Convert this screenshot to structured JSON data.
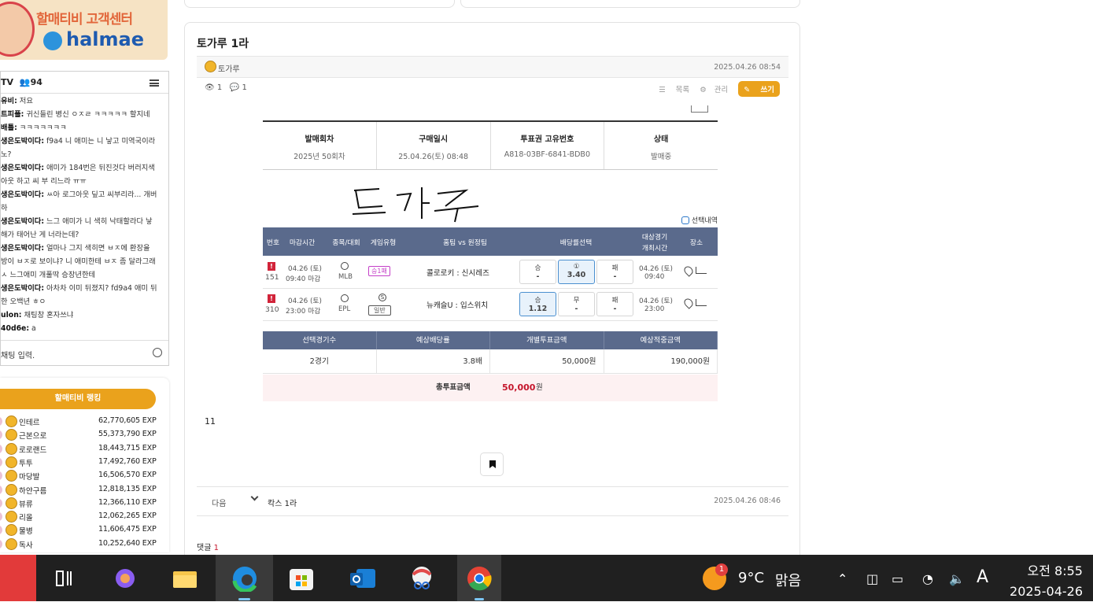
{
  "banner": {
    "title": "할매티비 고객센터",
    "brand": "halmae"
  },
  "chat": {
    "channel": "TV",
    "count": "94",
    "input_placeholder": "채팅 입력.",
    "messages": [
      {
        "user": "유비:",
        "text": " 저요"
      },
      {
        "user": "트피플:",
        "text": " 귀신들린 병신 ㅇㅈㄹ ㅋㅋㅋㅋㅋ 할지네"
      },
      {
        "user": "배틀:",
        "text": " ㅋㅋㅋㅋㅋㅋㅋ"
      },
      {
        "user": "생은도박이다:",
        "text": " f9a4 니 애미는 니 낳고 미역국이라"
      },
      {
        "user": "",
        "text": "노?"
      },
      {
        "user": "생은도박이다:",
        "text": " 애미가 184번은 뒤진것다 버러지색"
      },
      {
        "user": "",
        "text": "아웃 하고 씨 부 리느라 ㅠㅠ"
      },
      {
        "user": "생은도박이다:",
        "text": " ㅆ아 로그아웃 딮고 씨부리라... 개버"
      },
      {
        "user": "",
        "text": "하"
      },
      {
        "user": "생은도박이다:",
        "text": " 느그 애미가 니 색히 낙태할라다 낳"
      },
      {
        "user": "",
        "text": "해가 태어난 게 너라는데?"
      },
      {
        "user": "생은도박이다:",
        "text": " 얼마나 그지 색히면 ㅂㅈ에 환장을"
      },
      {
        "user": "",
        "text": "방이 ㅂㅈ로 보이냐? 니 애미한테 ㅂㅈ 좀 달라그래"
      },
      {
        "user": "",
        "text": "ㅅ 느그애미 개풀딱 승장년한테"
      },
      {
        "user": "생은도박이다:",
        "text": " 아차차 이미 뒤졌지? fd9a4 애미 뒤"
      },
      {
        "user": "",
        "text": "한 오백년 ㅎㅇ"
      },
      {
        "user": "ulon:",
        "text": " 채팅창 혼자쓰냐"
      },
      {
        "user": "40d6e:",
        "text": " a"
      }
    ]
  },
  "ranking": {
    "title": "할매티비 랭킹",
    "rows": [
      {
        "name": "인테르",
        "exp": "62,770,605 EXP"
      },
      {
        "name": "근본으로",
        "exp": "55,373,790 EXP"
      },
      {
        "name": "로로랜드",
        "exp": "18,443,715 EXP"
      },
      {
        "name": "투투",
        "exp": "17,492,760 EXP"
      },
      {
        "name": "마당발",
        "exp": "16,506,570 EXP"
      },
      {
        "name": "하얀구름",
        "exp": "12,818,135 EXP"
      },
      {
        "name": "뷰류",
        "exp": "12,366,110 EXP"
      },
      {
        "name": "리올",
        "exp": "12,062,265 EXP"
      },
      {
        "name": "물병",
        "exp": "11,606,475 EXP"
      },
      {
        "name": "독사",
        "exp": "10,252,640 EXP"
      }
    ]
  },
  "post": {
    "title": "토가루 1라",
    "author": "토가루",
    "date": "2025.04.26 08:54",
    "views": "1",
    "comments": "1",
    "actions": {
      "list": "목록",
      "manage": "관리",
      "write": "쓰기"
    },
    "body_text": "11",
    "next": {
      "label": "다음",
      "title": "칵스 1라",
      "date": "2025.04.26 08:46"
    },
    "comments_label": "댓글",
    "comments_count": "1"
  },
  "ticket": {
    "header": [
      {
        "h": "발매회차",
        "v": "2025년 50회차"
      },
      {
        "h": "구매일시",
        "v": "25.04.26(토) 08:48"
      },
      {
        "h": "투표권 고유번호",
        "v": "A818-03BF-6841-BDB0"
      },
      {
        "h": "상태",
        "v": "발매중"
      }
    ],
    "signature": "토가루",
    "select_label": "선택내역",
    "columns": {
      "num": "번호",
      "deadline": "마감시간",
      "league": "종목/대회",
      "type": "게임유형",
      "teams": "홈팀 vs 원정팀",
      "odds": "배당률선택",
      "time1": "대상경기",
      "time2": "개최시간",
      "place": "장소"
    },
    "games": [
      {
        "num": "151",
        "d1": "04.26 (토)",
        "d2": "09:40 마감",
        "league": "MLB",
        "type": "승1패",
        "teams": "콜로로키 : 신시레즈",
        "o1": {
          "l": "승",
          "v": "-"
        },
        "o2": {
          "l": "①",
          "v": "3.40"
        },
        "o3": {
          "l": "패",
          "v": "-"
        },
        "t1": "04.26 (토)",
        "t2": "09:40",
        "selected": "o2"
      },
      {
        "num": "310",
        "d1": "04.26 (토)",
        "d2": "23:00 마감",
        "league": "EPL",
        "type": "일반",
        "type_icon": "S",
        "teams": "뉴캐슬U : 입스위치",
        "o1": {
          "l": "승",
          "v": "1.12"
        },
        "o2": {
          "l": "무",
          "v": "-"
        },
        "o3": {
          "l": "패",
          "v": "-"
        },
        "t1": "04.26 (토)",
        "t2": "23:00",
        "selected": "o1"
      }
    ],
    "summary_head": [
      "선택경기수",
      "예상배당률",
      "개별투표금액",
      "예상적중금액"
    ],
    "summary": [
      "2경기",
      "3.8배",
      "50,000원",
      "190,000원"
    ],
    "total": {
      "label": "총투표금액",
      "value": "50,000",
      "unit": "원"
    }
  },
  "taskbar": {
    "weather_badge": "1",
    "temp": "9°C",
    "condition": "맑음",
    "ime": "A",
    "time": "오전 8:55",
    "date": "2025-04-26"
  }
}
